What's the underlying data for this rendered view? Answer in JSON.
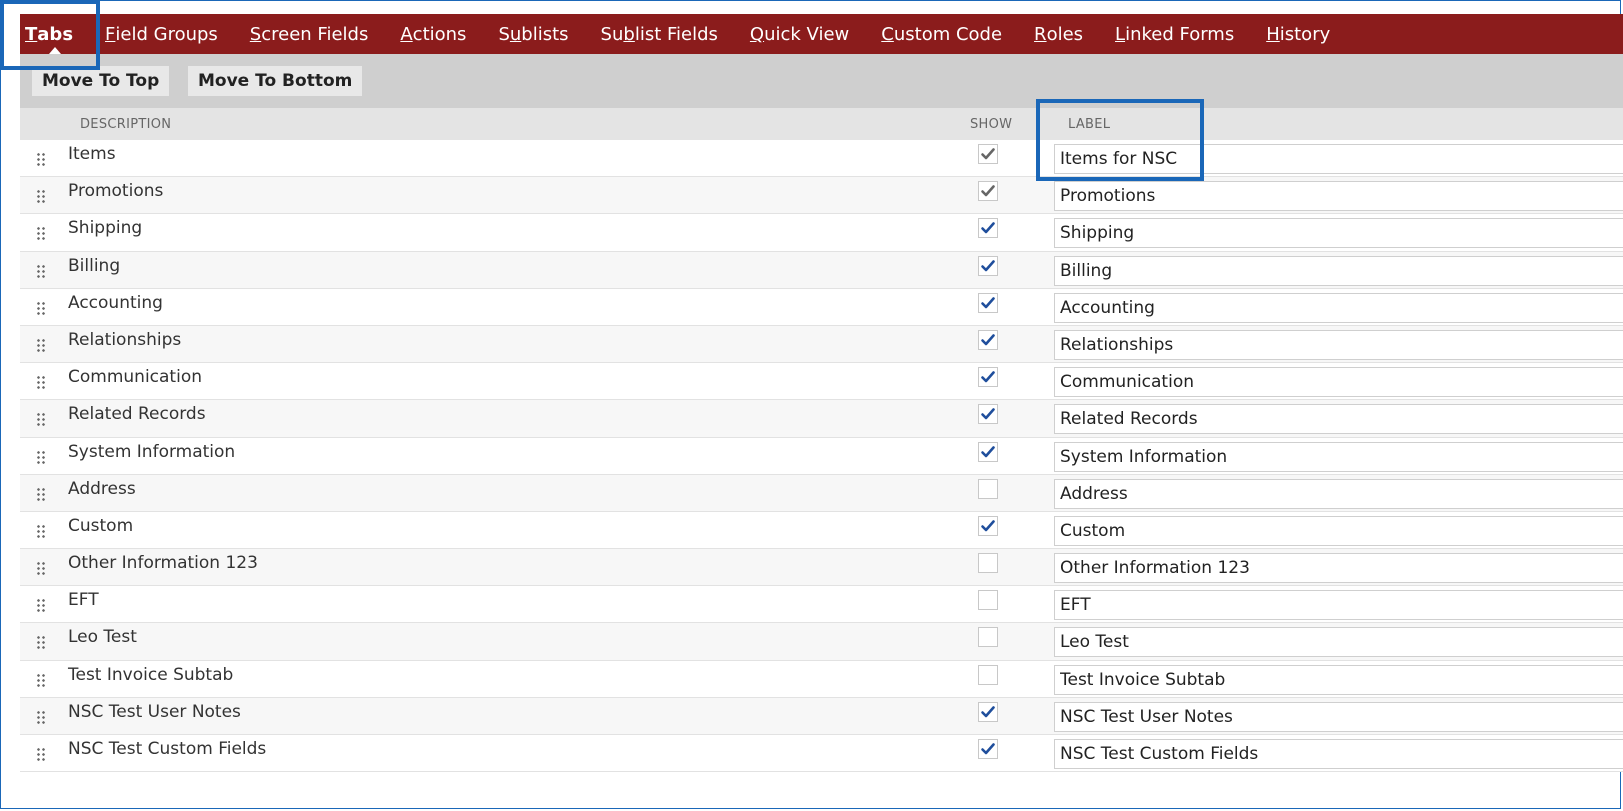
{
  "tabs": [
    {
      "acc": "T",
      "rest": "abs",
      "pre": "",
      "active": true
    },
    {
      "pre": "",
      "acc": "F",
      "rest": "ield Groups"
    },
    {
      "pre": "",
      "acc": "S",
      "rest": "creen Fields"
    },
    {
      "pre": "",
      "acc": "A",
      "rest": "ctions"
    },
    {
      "pre": "S",
      "acc": "u",
      "rest": "blists"
    },
    {
      "pre": "Su",
      "acc": "b",
      "rest": "list Fields"
    },
    {
      "pre": "",
      "acc": "Q",
      "rest": "uick View"
    },
    {
      "pre": "",
      "acc": "C",
      "rest": "ustom Code"
    },
    {
      "pre": "",
      "acc": "R",
      "rest": "oles"
    },
    {
      "pre": "",
      "acc": "L",
      "rest": "inked Forms"
    },
    {
      "pre": "",
      "acc": "H",
      "rest": "istory"
    }
  ],
  "toolbar": {
    "move_top": "Move To Top",
    "move_bottom": "Move To Bottom"
  },
  "columns": {
    "description": "DESCRIPTION",
    "show": "SHOW",
    "label": "LABEL"
  },
  "colors": {
    "tabbar": "#8b1c1c",
    "highlight": "#1a67b8",
    "check_gray": "#666666",
    "check_blue": "#1f4e9c"
  },
  "rows": [
    {
      "description": "Items",
      "show": "gray",
      "label": "Items for NSC"
    },
    {
      "description": "Promotions",
      "show": "gray",
      "label": "Promotions"
    },
    {
      "description": "Shipping",
      "show": "blue",
      "label": "Shipping"
    },
    {
      "description": "Billing",
      "show": "blue",
      "label": "Billing"
    },
    {
      "description": "Accounting",
      "show": "blue",
      "label": "Accounting"
    },
    {
      "description": "Relationships",
      "show": "blue",
      "label": "Relationships"
    },
    {
      "description": "Communication",
      "show": "blue",
      "label": "Communication"
    },
    {
      "description": "Related Records",
      "show": "blue",
      "label": "Related Records"
    },
    {
      "description": "System Information",
      "show": "blue",
      "label": "System Information"
    },
    {
      "description": "Address",
      "show": "none",
      "label": "Address"
    },
    {
      "description": "Custom",
      "show": "blue",
      "label": "Custom"
    },
    {
      "description": "Other Information 123",
      "show": "none",
      "label": "Other Information 123"
    },
    {
      "description": "EFT",
      "show": "none",
      "label": "EFT"
    },
    {
      "description": "Leo Test",
      "show": "none",
      "label": "Leo Test"
    },
    {
      "description": "Test Invoice Subtab",
      "show": "none",
      "label": "Test Invoice Subtab"
    },
    {
      "description": "NSC Test User Notes",
      "show": "blue",
      "label": "NSC Test User Notes"
    },
    {
      "description": "NSC Test Custom Fields",
      "show": "blue",
      "label": "NSC Test Custom Fields"
    }
  ]
}
